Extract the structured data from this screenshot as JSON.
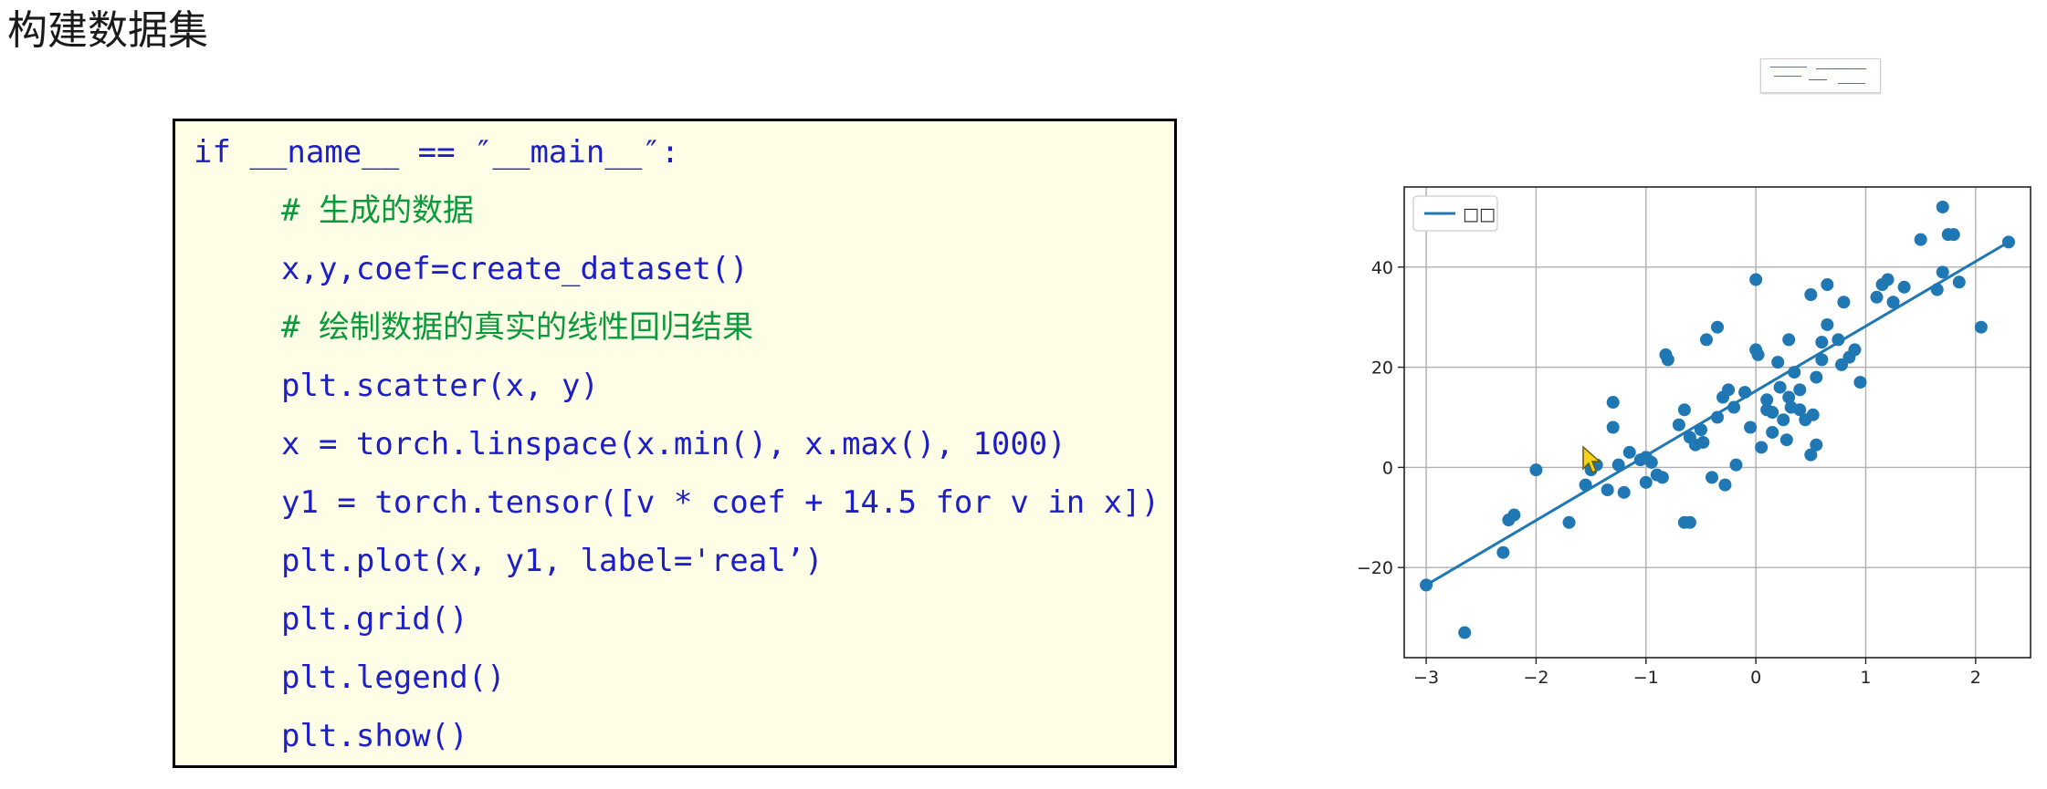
{
  "slide": {
    "title": "构建数据集"
  },
  "code": {
    "lines": [
      {
        "text": "if __name__ == ″__main__″:",
        "kind": "code",
        "indent": 0
      },
      {
        "text": "# 生成的数据",
        "kind": "comment",
        "indent": 1
      },
      {
        "text": "x,y,coef=create_dataset()",
        "kind": "code",
        "indent": 1
      },
      {
        "text": "# 绘制数据的真实的线性回归结果",
        "kind": "comment",
        "indent": 1
      },
      {
        "text": "plt.scatter(x, y)",
        "kind": "code",
        "indent": 1
      },
      {
        "text": "x = torch.linspace(x.min(), x.max(), 1000)",
        "kind": "code",
        "indent": 1
      },
      {
        "text": "y1 = torch.tensor([v * coef + 14.5 for v in x])",
        "kind": "code",
        "indent": 1
      },
      {
        "text": "plt.plot(x, y1, label='real’)",
        "kind": "code",
        "indent": 1
      },
      {
        "text": "plt.grid()",
        "kind": "code",
        "indent": 1
      },
      {
        "text": "plt.legend()",
        "kind": "code",
        "indent": 1
      },
      {
        "text": "plt.show()",
        "kind": "code",
        "indent": 1
      }
    ],
    "colors": {
      "code": "#1d1dc9",
      "comment": "#0a9a3c",
      "background": "#fefee6"
    }
  },
  "chart_data": {
    "type": "scatter",
    "title": "",
    "xlabel": "",
    "ylabel": "",
    "xlim": [
      -3.2,
      2.5
    ],
    "ylim": [
      -38,
      56
    ],
    "xticks": [
      -3,
      -2,
      -1,
      0,
      1,
      2
    ],
    "xtick_labels": [
      "−3",
      "−2",
      "−1",
      "0",
      "1",
      "2"
    ],
    "yticks": [
      -20,
      0,
      20,
      40
    ],
    "ytick_labels": [
      "−20",
      "0",
      "20",
      "40"
    ],
    "grid": true,
    "legend": {
      "position": "top-left",
      "entries": [
        {
          "label": "□□",
          "marker": "line",
          "color": "#1f77b4"
        }
      ]
    },
    "line": {
      "x": [
        -3.0,
        2.3
      ],
      "y": [
        -23.5,
        45.0
      ],
      "color": "#1f77b4"
    },
    "scatter": {
      "color": "#1f77b4",
      "x": [
        -3.0,
        -2.65,
        -2.3,
        -2.25,
        -2.2,
        -2.0,
        -1.7,
        -1.55,
        -1.5,
        -1.45,
        -1.35,
        -1.3,
        -1.3,
        -1.25,
        -1.2,
        -1.15,
        -1.05,
        -1.0,
        -0.95,
        -0.9,
        -0.85,
        -0.82,
        -0.8,
        -0.7,
        -0.65,
        -0.6,
        -0.6,
        -0.55,
        -0.5,
        -0.48,
        -0.45,
        -0.4,
        -0.35,
        -0.3,
        -0.28,
        -0.25,
        -0.2,
        -0.18,
        -0.1,
        -0.05,
        0.0,
        0.0,
        0.02,
        0.05,
        0.1,
        0.15,
        0.2,
        0.22,
        0.25,
        0.28,
        0.3,
        0.3,
        0.32,
        0.35,
        0.4,
        0.45,
        0.5,
        0.5,
        0.52,
        0.55,
        0.6,
        0.6,
        0.65,
        0.75,
        0.78,
        0.8,
        0.85,
        0.9,
        0.95,
        1.1,
        1.15,
        1.2,
        1.25,
        1.35,
        1.5,
        1.65,
        1.7,
        1.75,
        1.8,
        1.85,
        2.05,
        2.3,
        1.7,
        -0.35,
        0.65,
        -0.65,
        0.15,
        0.4,
        0.55,
        -1.0,
        0.1
      ],
      "y": [
        -23.5,
        -33.0,
        -17.0,
        -10.5,
        -9.5,
        -0.5,
        -11.0,
        -3.5,
        -0.5,
        0.5,
        -4.5,
        13.0,
        8.0,
        0.5,
        -5.0,
        3.0,
        1.5,
        2.0,
        1.0,
        -1.5,
        -2.0,
        22.5,
        21.5,
        8.5,
        11.5,
        -11.0,
        6.0,
        4.5,
        7.5,
        5.0,
        25.5,
        -2.0,
        10.0,
        14.0,
        -3.5,
        15.5,
        12.0,
        0.5,
        15.0,
        8.0,
        37.5,
        23.5,
        22.5,
        4.0,
        13.5,
        7.0,
        21.0,
        16.0,
        9.5,
        5.5,
        25.5,
        14.0,
        12.0,
        19.0,
        11.5,
        9.5,
        34.5,
        2.5,
        10.5,
        18.0,
        25.0,
        21.5,
        28.5,
        25.5,
        20.5,
        33.0,
        22.0,
        23.5,
        17.0,
        34.0,
        36.5,
        37.5,
        33.0,
        36.0,
        45.5,
        35.5,
        52.0,
        46.5,
        46.5,
        37.0,
        28.0,
        45.0,
        39.0,
        28.0,
        36.5,
        -11.0,
        11.0,
        15.5,
        4.5,
        -3.0,
        11.5
      ]
    }
  },
  "thumbnail": {
    "icon": "slide-thumbnail-icon"
  },
  "cursor": {
    "icon": "mouse-pointer-icon",
    "color": "#f5d21b"
  }
}
